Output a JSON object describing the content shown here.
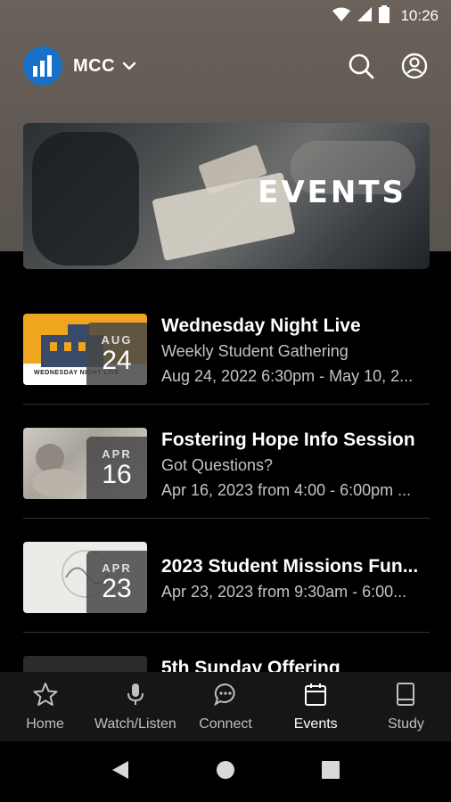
{
  "status_bar": {
    "time": "10:26"
  },
  "header": {
    "brand": "MCC"
  },
  "hero": {
    "title": "EVENTS"
  },
  "events": [
    {
      "month": "AUG",
      "day": "24",
      "title": "Wednesday Night Live",
      "subtitle": "Weekly Student Gathering",
      "date_line": "Aug 24, 2022 6:30pm - May 10, 2...",
      "thumb_caption": "WEDNESDAY NIGHT LIVE"
    },
    {
      "month": "APR",
      "day": "16",
      "title": "Fostering Hope Info Session",
      "subtitle": "Got Questions?",
      "date_line": "Apr 16, 2023 from 4:00 - 6:00pm ..."
    },
    {
      "month": "APR",
      "day": "23",
      "title": "2023 Student Missions Fun...",
      "date_line": "Apr 23, 2023 from 9:30am - 6:00..."
    },
    {
      "title": "5th Sunday Offering"
    }
  ],
  "nav": {
    "items": [
      {
        "label": "Home",
        "icon": "star-icon"
      },
      {
        "label": "Watch/Listen",
        "icon": "microphone-icon"
      },
      {
        "label": "Connect",
        "icon": "chat-icon"
      },
      {
        "label": "Events",
        "icon": "calendar-icon",
        "active": true
      },
      {
        "label": "Study",
        "icon": "book-icon"
      }
    ]
  },
  "colors": {
    "logo": "#1a6fc6",
    "thumb1": "#f0a51e",
    "nav_bg": "#161616"
  }
}
